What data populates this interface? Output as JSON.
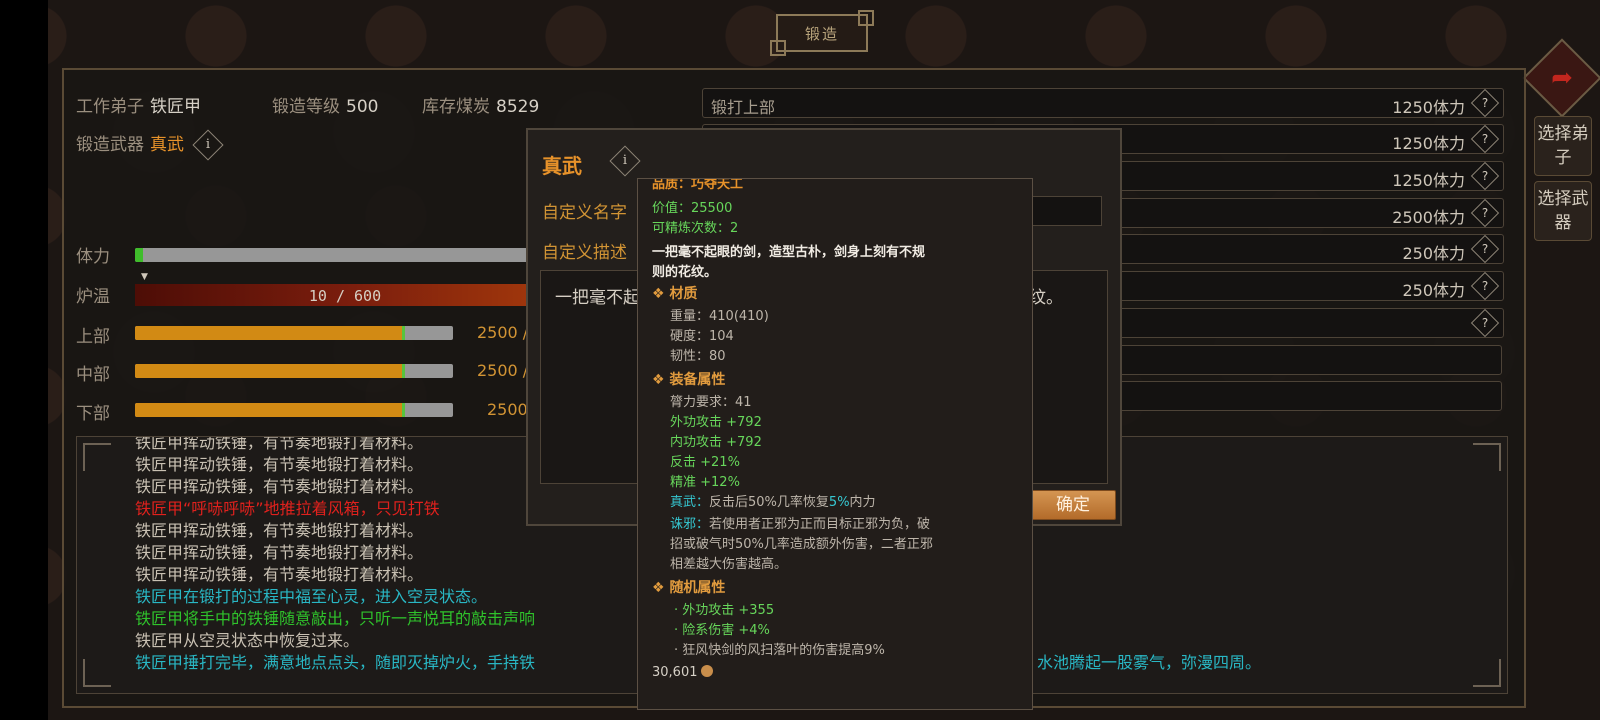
{
  "header": {
    "title": "锻造"
  },
  "info": {
    "disciple_label": "工作弟子",
    "disciple_value": "铁匠甲",
    "level_label": "锻造等级",
    "level_value": "500",
    "coal_label": "库存煤炭",
    "coal_value": "8529",
    "weapon_label": "锻造武器",
    "weapon_value": "真武"
  },
  "bars": {
    "stamina_label": "体力",
    "stamina_progress": 0.02,
    "heat_label": "炉温",
    "heat_value": "10 / 600",
    "upper_label": "上部",
    "upper_value": "2500 /",
    "upper_progress": 0.84,
    "middle_label": "中部",
    "middle_value": "2500 /",
    "middle_progress": 0.84,
    "lower_label": "下部",
    "lower_value": "2500",
    "lower_progress": 0.84
  },
  "steps": [
    {
      "label": "锻打上部",
      "cost": "1250体力"
    },
    {
      "label": "",
      "cost": "1250体力"
    },
    {
      "label": "",
      "cost": "1250体力"
    },
    {
      "label": "",
      "cost": "2500体力"
    },
    {
      "label": "",
      "cost": "250体力"
    },
    {
      "label": "",
      "cost": "250体力"
    },
    {
      "label": "",
      "cost": ""
    },
    {
      "label": "",
      "cost": ""
    },
    {
      "label": "",
      "cost": ""
    }
  ],
  "side_buttons": {
    "select_disciple": "选择弟子",
    "select_weapon": "选择武器"
  },
  "log": [
    {
      "text": "铁匠甲挥动铁锤，有节奏地锻打着材料。",
      "color": "#c9c1b3"
    },
    {
      "text": "铁匠甲挥动铁锤，有节奏地锻打着材料。",
      "color": "#c9c1b3"
    },
    {
      "text": "铁匠甲挥动铁锤，有节奏地锻打着材料。",
      "color": "#c9c1b3"
    },
    {
      "text": "铁匠甲“呼哧呼哧”地推拉着风箱，只见打铁",
      "color": "#e0211d"
    },
    {
      "text": "铁匠甲挥动铁锤，有节奏地锻打着材料。",
      "color": "#c9c1b3"
    },
    {
      "text": "铁匠甲挥动铁锤，有节奏地锻打着材料。",
      "color": "#c9c1b3"
    },
    {
      "text": "铁匠甲挥动铁锤，有节奏地锻打着材料。",
      "color": "#c9c1b3"
    },
    {
      "text": "铁匠甲在锻打的过程中福至心灵，进入空灵状态。",
      "color": "#29b7c4"
    },
    {
      "text": "铁匠甲将手中的铁锤随意敲出，只听一声悦耳的敲击声响",
      "color": "#2fc22b"
    },
    {
      "text": "铁匠甲从空灵状态中恢复过来。",
      "color": "#c9c1b3"
    },
    {
      "text": "铁匠甲捶打完毕，满意地点点头，随即灭掉炉火，手持铁",
      "color": "#29b7c4"
    }
  ],
  "log_tail": "水池腾起一股雾气，弥漫四周。",
  "dialog": {
    "title": "真武",
    "name_label": "自定义名字",
    "desc_label": "自定义描述",
    "desc_text": "一把毫不起",
    "desc_tail": "纹。",
    "confirm_button": "确定"
  },
  "tooltip": {
    "quality": "品质：巧夺天工",
    "value": "价值：25500",
    "refine": "可精炼次数：2",
    "desc_line1": "一把毫不起眼的剑，造型古朴，剑身上刻有不规",
    "desc_line2": "则的花纹。",
    "material_head": "材质",
    "weight": "重量：410(410)",
    "hardness": "硬度：104",
    "toughness": "韧性：80",
    "equip_head": "装备属性",
    "strength_req": "膂力要求：41",
    "outer_atk": "外功攻击 +792",
    "inner_atk": "内功攻击 +792",
    "counter": "反击 +21%",
    "precision": "精准 +12%",
    "zhenwu_name": "真武：",
    "zhenwu_text_a": "反击后50%几率恢复",
    "zhenwu_pct": "5%",
    "zhenwu_text_b": "内力",
    "zhuxie_name": "诛邪：",
    "zhuxie_line1": "若使用者正邪为正而目标正邪为负，破",
    "zhuxie_line2": "招或破气时50%几率造成额外伤害，二者正邪",
    "zhuxie_line3": "相差越大伤害越高。",
    "random_head": "随机属性",
    "rand1": "· 外功攻击 +355",
    "rand2": "· 险系伤害 +4%",
    "rand3": "· 狂风快剑的风扫落叶的伤害提高9%",
    "coins": "30,601"
  }
}
